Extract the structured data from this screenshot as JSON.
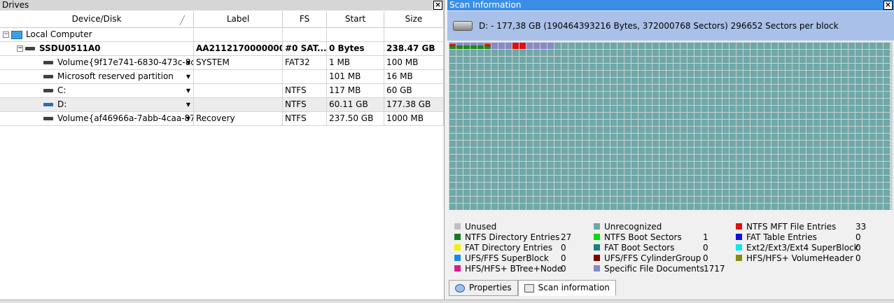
{
  "drives": {
    "title": "Drives",
    "columns": [
      "Device/Disk",
      "Label",
      "FS",
      "Start",
      "Size"
    ],
    "rows": [
      {
        "device": "Local Computer",
        "label": "",
        "fs": "",
        "start": "",
        "size": ""
      },
      {
        "device": "SSDU0511A0",
        "label": "AA2112170000000...",
        "fs": "#0 SAT...",
        "start": "0 Bytes",
        "size": "238.47 GB"
      },
      {
        "device": "Volume{9f17e741-6830-473c-8d...",
        "label": "SYSTEM",
        "fs": "FAT32",
        "start": "1 MB",
        "size": "100 MB"
      },
      {
        "device": "Microsoft reserved partition",
        "label": "",
        "fs": "",
        "start": "101 MB",
        "size": "16 MB"
      },
      {
        "device": "C:",
        "label": "",
        "fs": "NTFS",
        "start": "117 MB",
        "size": "60 GB"
      },
      {
        "device": "D:",
        "label": "",
        "fs": "NTFS",
        "start": "60.11 GB",
        "size": "177.38 GB"
      },
      {
        "device": "Volume{af46966a-7abb-4caa-87...",
        "label": "Recovery",
        "fs": "NTFS",
        "start": "237.50 GB",
        "size": "1000 MB"
      }
    ]
  },
  "scan": {
    "title": "Scan Information",
    "info": "D: - 177,38 GB (190464393216 Bytes, 372000768 Sectors) 296652 Sectors per block",
    "colors": {
      "unrecognized": "#6fa8a8",
      "used_dir": "#1a8a1a",
      "mft": "#e01010",
      "spec": "#8a88c8"
    },
    "legend": [
      {
        "label": "Unused",
        "count": "",
        "color": "#c0c0c0"
      },
      {
        "label": "NTFS Directory Entries",
        "count": "27",
        "color": "#1a7a1a"
      },
      {
        "label": "FAT Directory Entries",
        "count": "0",
        "color": "#f0f000"
      },
      {
        "label": "UFS/FFS SuperBlock",
        "count": "0",
        "color": "#1a8ae8"
      },
      {
        "label": "HFS/HFS+ BTree+Node",
        "count": "0",
        "color": "#e01a8a"
      },
      {
        "label": "Unrecognized",
        "count": "",
        "color": "#6fa8a8"
      },
      {
        "label": "NTFS Boot Sectors",
        "count": "1",
        "color": "#00e000"
      },
      {
        "label": "FAT Boot Sectors",
        "count": "0",
        "color": "#1a8080"
      },
      {
        "label": "UFS/FFS CylinderGroup",
        "count": "0",
        "color": "#800000"
      },
      {
        "label": "Specific File Documents",
        "count": "1717",
        "color": "#8a88c8"
      },
      {
        "label": "NTFS MFT File Entries",
        "count": "33",
        "color": "#e01010"
      },
      {
        "label": "FAT Table Entries",
        "count": "0",
        "color": "#1010e0"
      },
      {
        "label": "Ext2/Ext3/Ext4 SuperBlock",
        "count": "0",
        "color": "#10e8e8"
      },
      {
        "label": "HFS/HFS+ VolumeHeader",
        "count": "0",
        "color": "#8a8a10"
      }
    ],
    "tabs": [
      "Properties",
      "Scan information"
    ]
  }
}
